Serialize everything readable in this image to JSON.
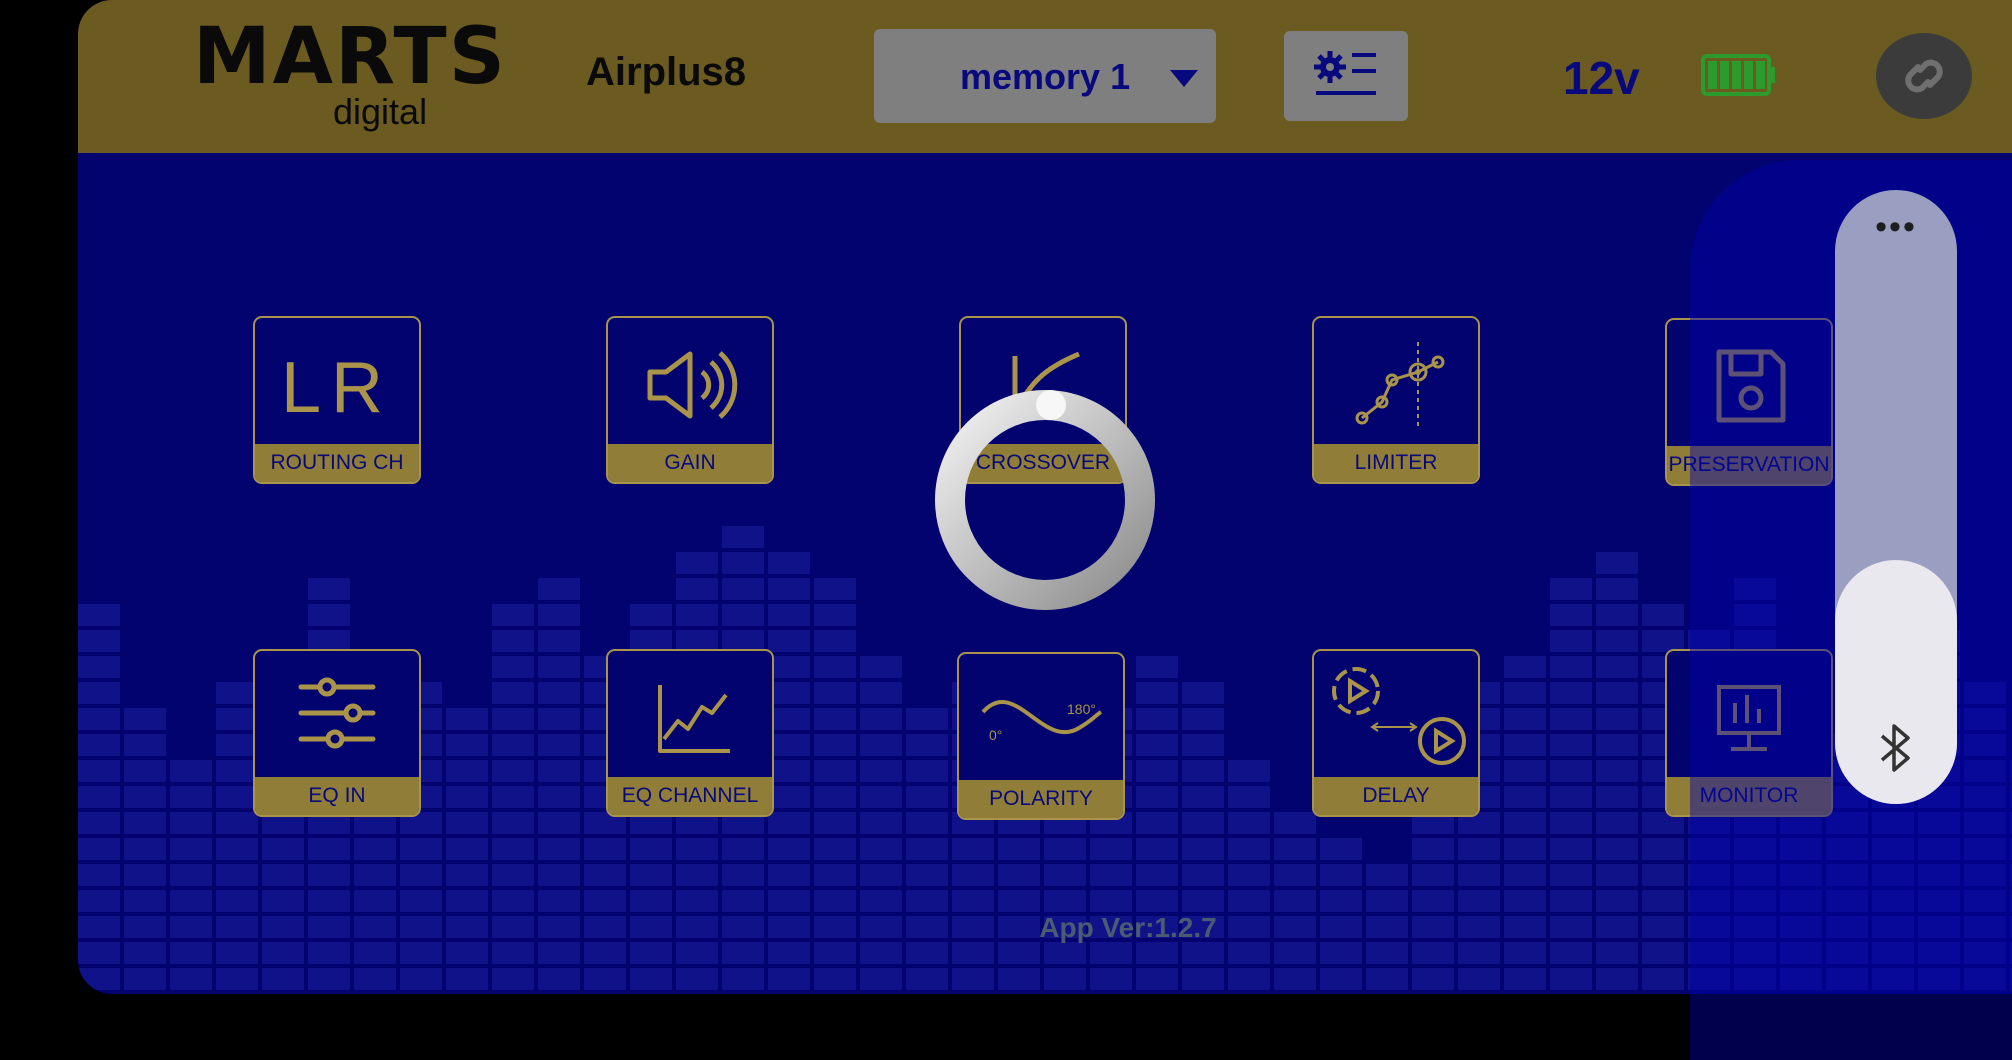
{
  "header": {
    "logo_main": "MARTS",
    "logo_sub": "digital",
    "device_name": "Airplus8",
    "memory_select": {
      "value": "memory 1"
    },
    "voltage": "12v",
    "battery_level": 1.0
  },
  "tiles": [
    {
      "label": "ROUTING CH",
      "icon_text": "LR"
    },
    {
      "label": "GAIN"
    },
    {
      "label": "CROSSOVER"
    },
    {
      "label": "LIMITER"
    },
    {
      "label": "PRESERVATION"
    },
    {
      "label": "EQ IN"
    },
    {
      "label": "EQ CHANNEL"
    },
    {
      "label": "POLARITY",
      "left_text": "0°",
      "right_text": "180°"
    },
    {
      "label": "DELAY"
    },
    {
      "label": "MONITOR"
    }
  ],
  "footer": {
    "version": "App Ver:1.2.7"
  },
  "side_panel": {
    "menu_glyph": "•••",
    "icon": "bluetooth-icon"
  },
  "colors": {
    "background": "#02036e",
    "header": "#6b5b20",
    "gold": "#a9944a",
    "label_bg": "#907d37",
    "text_blue": "#07097d",
    "battery_green": "#2d9a2d"
  }
}
